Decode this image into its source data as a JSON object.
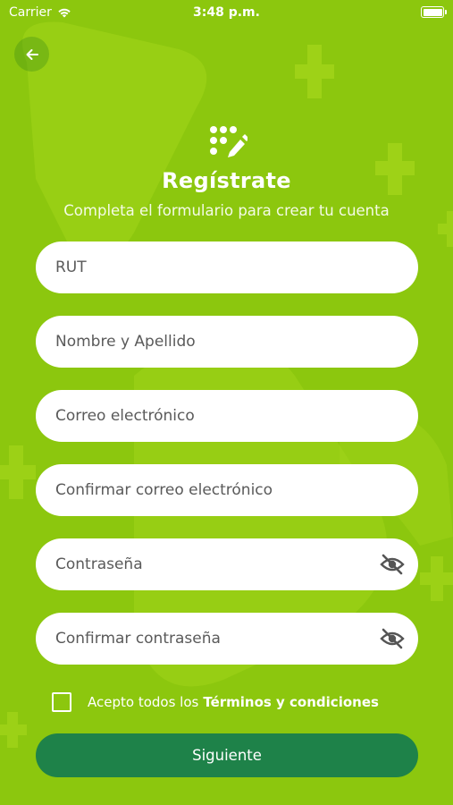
{
  "status_bar": {
    "carrier": "Carrier",
    "time": "3:48 p.m."
  },
  "header": {
    "title": "Regístrate",
    "subtitle": "Completa el formulario para crear tu cuenta"
  },
  "form": {
    "fields": [
      {
        "placeholder": "RUT",
        "value": ""
      },
      {
        "placeholder": "Nombre y Apellido",
        "value": ""
      },
      {
        "placeholder": "Correo electrónico",
        "value": ""
      },
      {
        "placeholder": "Confirmar correo electrónico",
        "value": ""
      },
      {
        "placeholder": "Contraseña",
        "value": ""
      },
      {
        "placeholder": "Confirmar contraseña",
        "value": ""
      }
    ],
    "terms_prefix": "Acepto todos los",
    "terms_link": "Términos y condiciones",
    "terms_checked": false,
    "submit_label": "Siguiente"
  },
  "icons": {
    "back": "arrow-left-icon",
    "logo": "dots-pencil-icon",
    "password_toggle": "eye-off-icon",
    "wifi": "wifi-icon",
    "battery": "battery-icon"
  },
  "colors": {
    "background": "#8cc70e",
    "pattern": "#a2d51a",
    "primary_button": "#1e8249",
    "field_background": "#ffffff",
    "text_on_green": "#ffffff"
  }
}
